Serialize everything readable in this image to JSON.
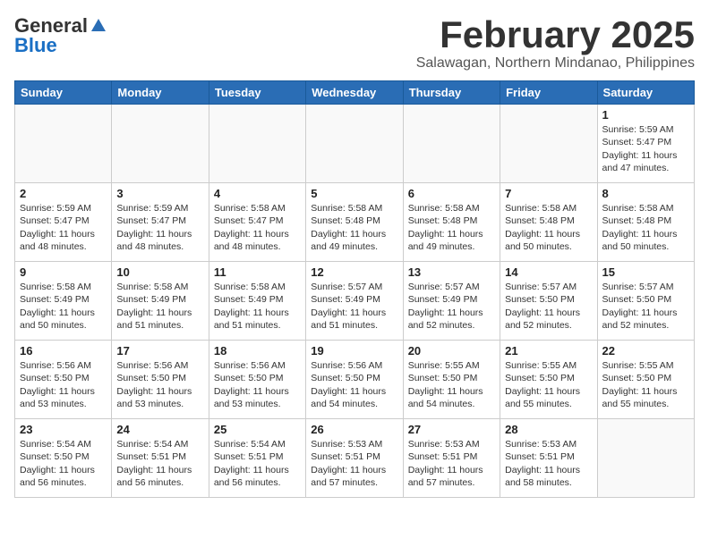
{
  "header": {
    "logo_general": "General",
    "logo_blue": "Blue",
    "title": "February 2025",
    "subtitle": "Salawagan, Northern Mindanao, Philippines"
  },
  "weekdays": [
    "Sunday",
    "Monday",
    "Tuesday",
    "Wednesday",
    "Thursday",
    "Friday",
    "Saturday"
  ],
  "weeks": [
    [
      {
        "day": "",
        "info": ""
      },
      {
        "day": "",
        "info": ""
      },
      {
        "day": "",
        "info": ""
      },
      {
        "day": "",
        "info": ""
      },
      {
        "day": "",
        "info": ""
      },
      {
        "day": "",
        "info": ""
      },
      {
        "day": "1",
        "info": "Sunrise: 5:59 AM\nSunset: 5:47 PM\nDaylight: 11 hours\nand 47 minutes."
      }
    ],
    [
      {
        "day": "2",
        "info": "Sunrise: 5:59 AM\nSunset: 5:47 PM\nDaylight: 11 hours\nand 48 minutes."
      },
      {
        "day": "3",
        "info": "Sunrise: 5:59 AM\nSunset: 5:47 PM\nDaylight: 11 hours\nand 48 minutes."
      },
      {
        "day": "4",
        "info": "Sunrise: 5:58 AM\nSunset: 5:47 PM\nDaylight: 11 hours\nand 48 minutes."
      },
      {
        "day": "5",
        "info": "Sunrise: 5:58 AM\nSunset: 5:48 PM\nDaylight: 11 hours\nand 49 minutes."
      },
      {
        "day": "6",
        "info": "Sunrise: 5:58 AM\nSunset: 5:48 PM\nDaylight: 11 hours\nand 49 minutes."
      },
      {
        "day": "7",
        "info": "Sunrise: 5:58 AM\nSunset: 5:48 PM\nDaylight: 11 hours\nand 50 minutes."
      },
      {
        "day": "8",
        "info": "Sunrise: 5:58 AM\nSunset: 5:48 PM\nDaylight: 11 hours\nand 50 minutes."
      }
    ],
    [
      {
        "day": "9",
        "info": "Sunrise: 5:58 AM\nSunset: 5:49 PM\nDaylight: 11 hours\nand 50 minutes."
      },
      {
        "day": "10",
        "info": "Sunrise: 5:58 AM\nSunset: 5:49 PM\nDaylight: 11 hours\nand 51 minutes."
      },
      {
        "day": "11",
        "info": "Sunrise: 5:58 AM\nSunset: 5:49 PM\nDaylight: 11 hours\nand 51 minutes."
      },
      {
        "day": "12",
        "info": "Sunrise: 5:57 AM\nSunset: 5:49 PM\nDaylight: 11 hours\nand 51 minutes."
      },
      {
        "day": "13",
        "info": "Sunrise: 5:57 AM\nSunset: 5:49 PM\nDaylight: 11 hours\nand 52 minutes."
      },
      {
        "day": "14",
        "info": "Sunrise: 5:57 AM\nSunset: 5:50 PM\nDaylight: 11 hours\nand 52 minutes."
      },
      {
        "day": "15",
        "info": "Sunrise: 5:57 AM\nSunset: 5:50 PM\nDaylight: 11 hours\nand 52 minutes."
      }
    ],
    [
      {
        "day": "16",
        "info": "Sunrise: 5:56 AM\nSunset: 5:50 PM\nDaylight: 11 hours\nand 53 minutes."
      },
      {
        "day": "17",
        "info": "Sunrise: 5:56 AM\nSunset: 5:50 PM\nDaylight: 11 hours\nand 53 minutes."
      },
      {
        "day": "18",
        "info": "Sunrise: 5:56 AM\nSunset: 5:50 PM\nDaylight: 11 hours\nand 53 minutes."
      },
      {
        "day": "19",
        "info": "Sunrise: 5:56 AM\nSunset: 5:50 PM\nDaylight: 11 hours\nand 54 minutes."
      },
      {
        "day": "20",
        "info": "Sunrise: 5:55 AM\nSunset: 5:50 PM\nDaylight: 11 hours\nand 54 minutes."
      },
      {
        "day": "21",
        "info": "Sunrise: 5:55 AM\nSunset: 5:50 PM\nDaylight: 11 hours\nand 55 minutes."
      },
      {
        "day": "22",
        "info": "Sunrise: 5:55 AM\nSunset: 5:50 PM\nDaylight: 11 hours\nand 55 minutes."
      }
    ],
    [
      {
        "day": "23",
        "info": "Sunrise: 5:54 AM\nSunset: 5:50 PM\nDaylight: 11 hours\nand 56 minutes."
      },
      {
        "day": "24",
        "info": "Sunrise: 5:54 AM\nSunset: 5:51 PM\nDaylight: 11 hours\nand 56 minutes."
      },
      {
        "day": "25",
        "info": "Sunrise: 5:54 AM\nSunset: 5:51 PM\nDaylight: 11 hours\nand 56 minutes."
      },
      {
        "day": "26",
        "info": "Sunrise: 5:53 AM\nSunset: 5:51 PM\nDaylight: 11 hours\nand 57 minutes."
      },
      {
        "day": "27",
        "info": "Sunrise: 5:53 AM\nSunset: 5:51 PM\nDaylight: 11 hours\nand 57 minutes."
      },
      {
        "day": "28",
        "info": "Sunrise: 5:53 AM\nSunset: 5:51 PM\nDaylight: 11 hours\nand 58 minutes."
      },
      {
        "day": "",
        "info": ""
      }
    ]
  ]
}
